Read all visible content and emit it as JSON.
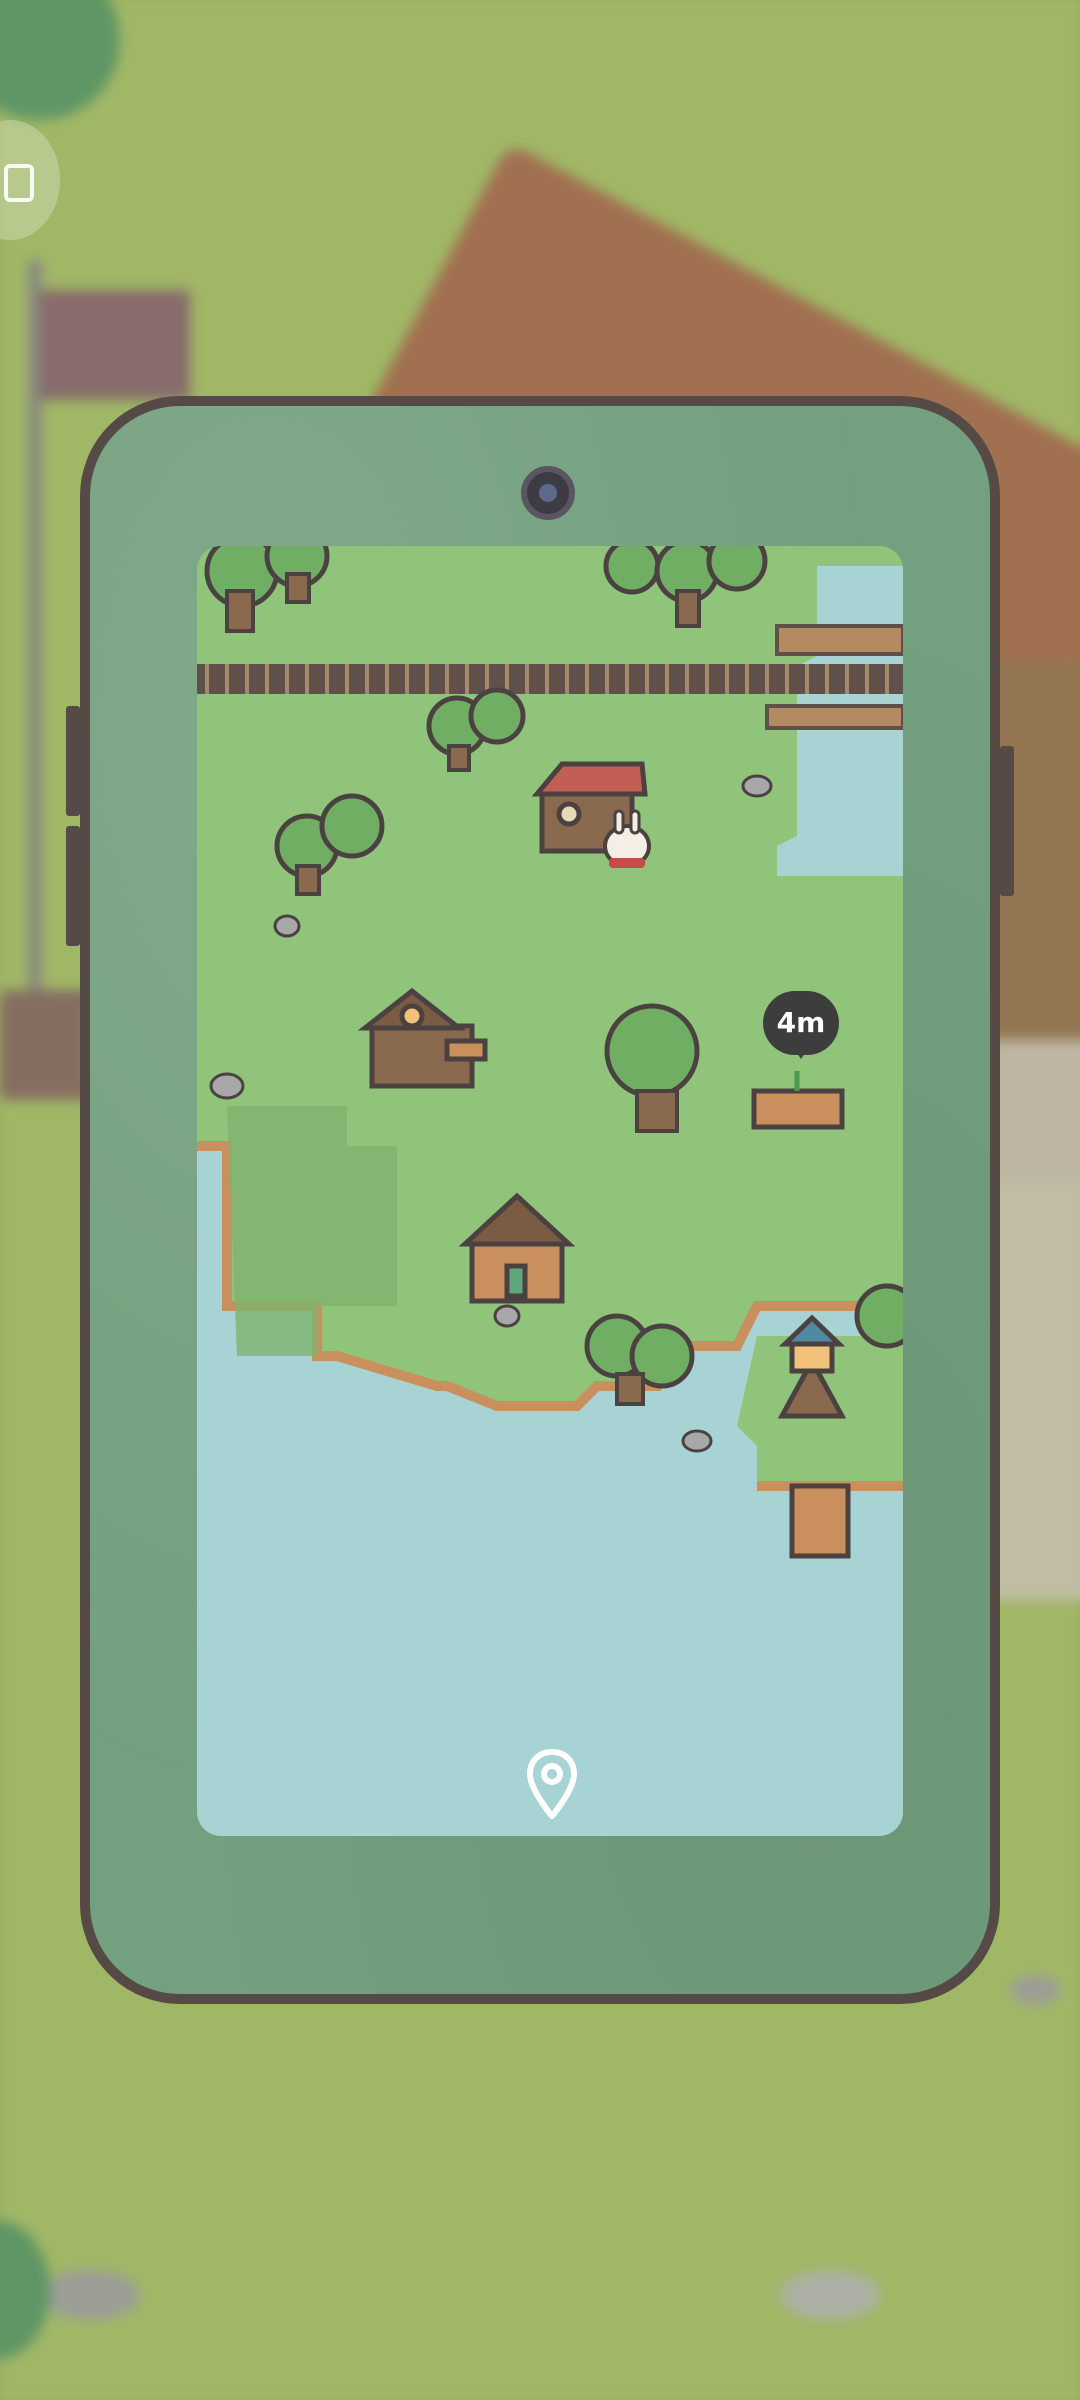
{
  "map": {
    "distance_badge": "4m",
    "location_icon": "location-pin-icon"
  },
  "colors": {
    "water": "#a7d3d4",
    "grass": "#90c47a",
    "phone_case": "#73a07e",
    "phone_border": "#554a45"
  }
}
